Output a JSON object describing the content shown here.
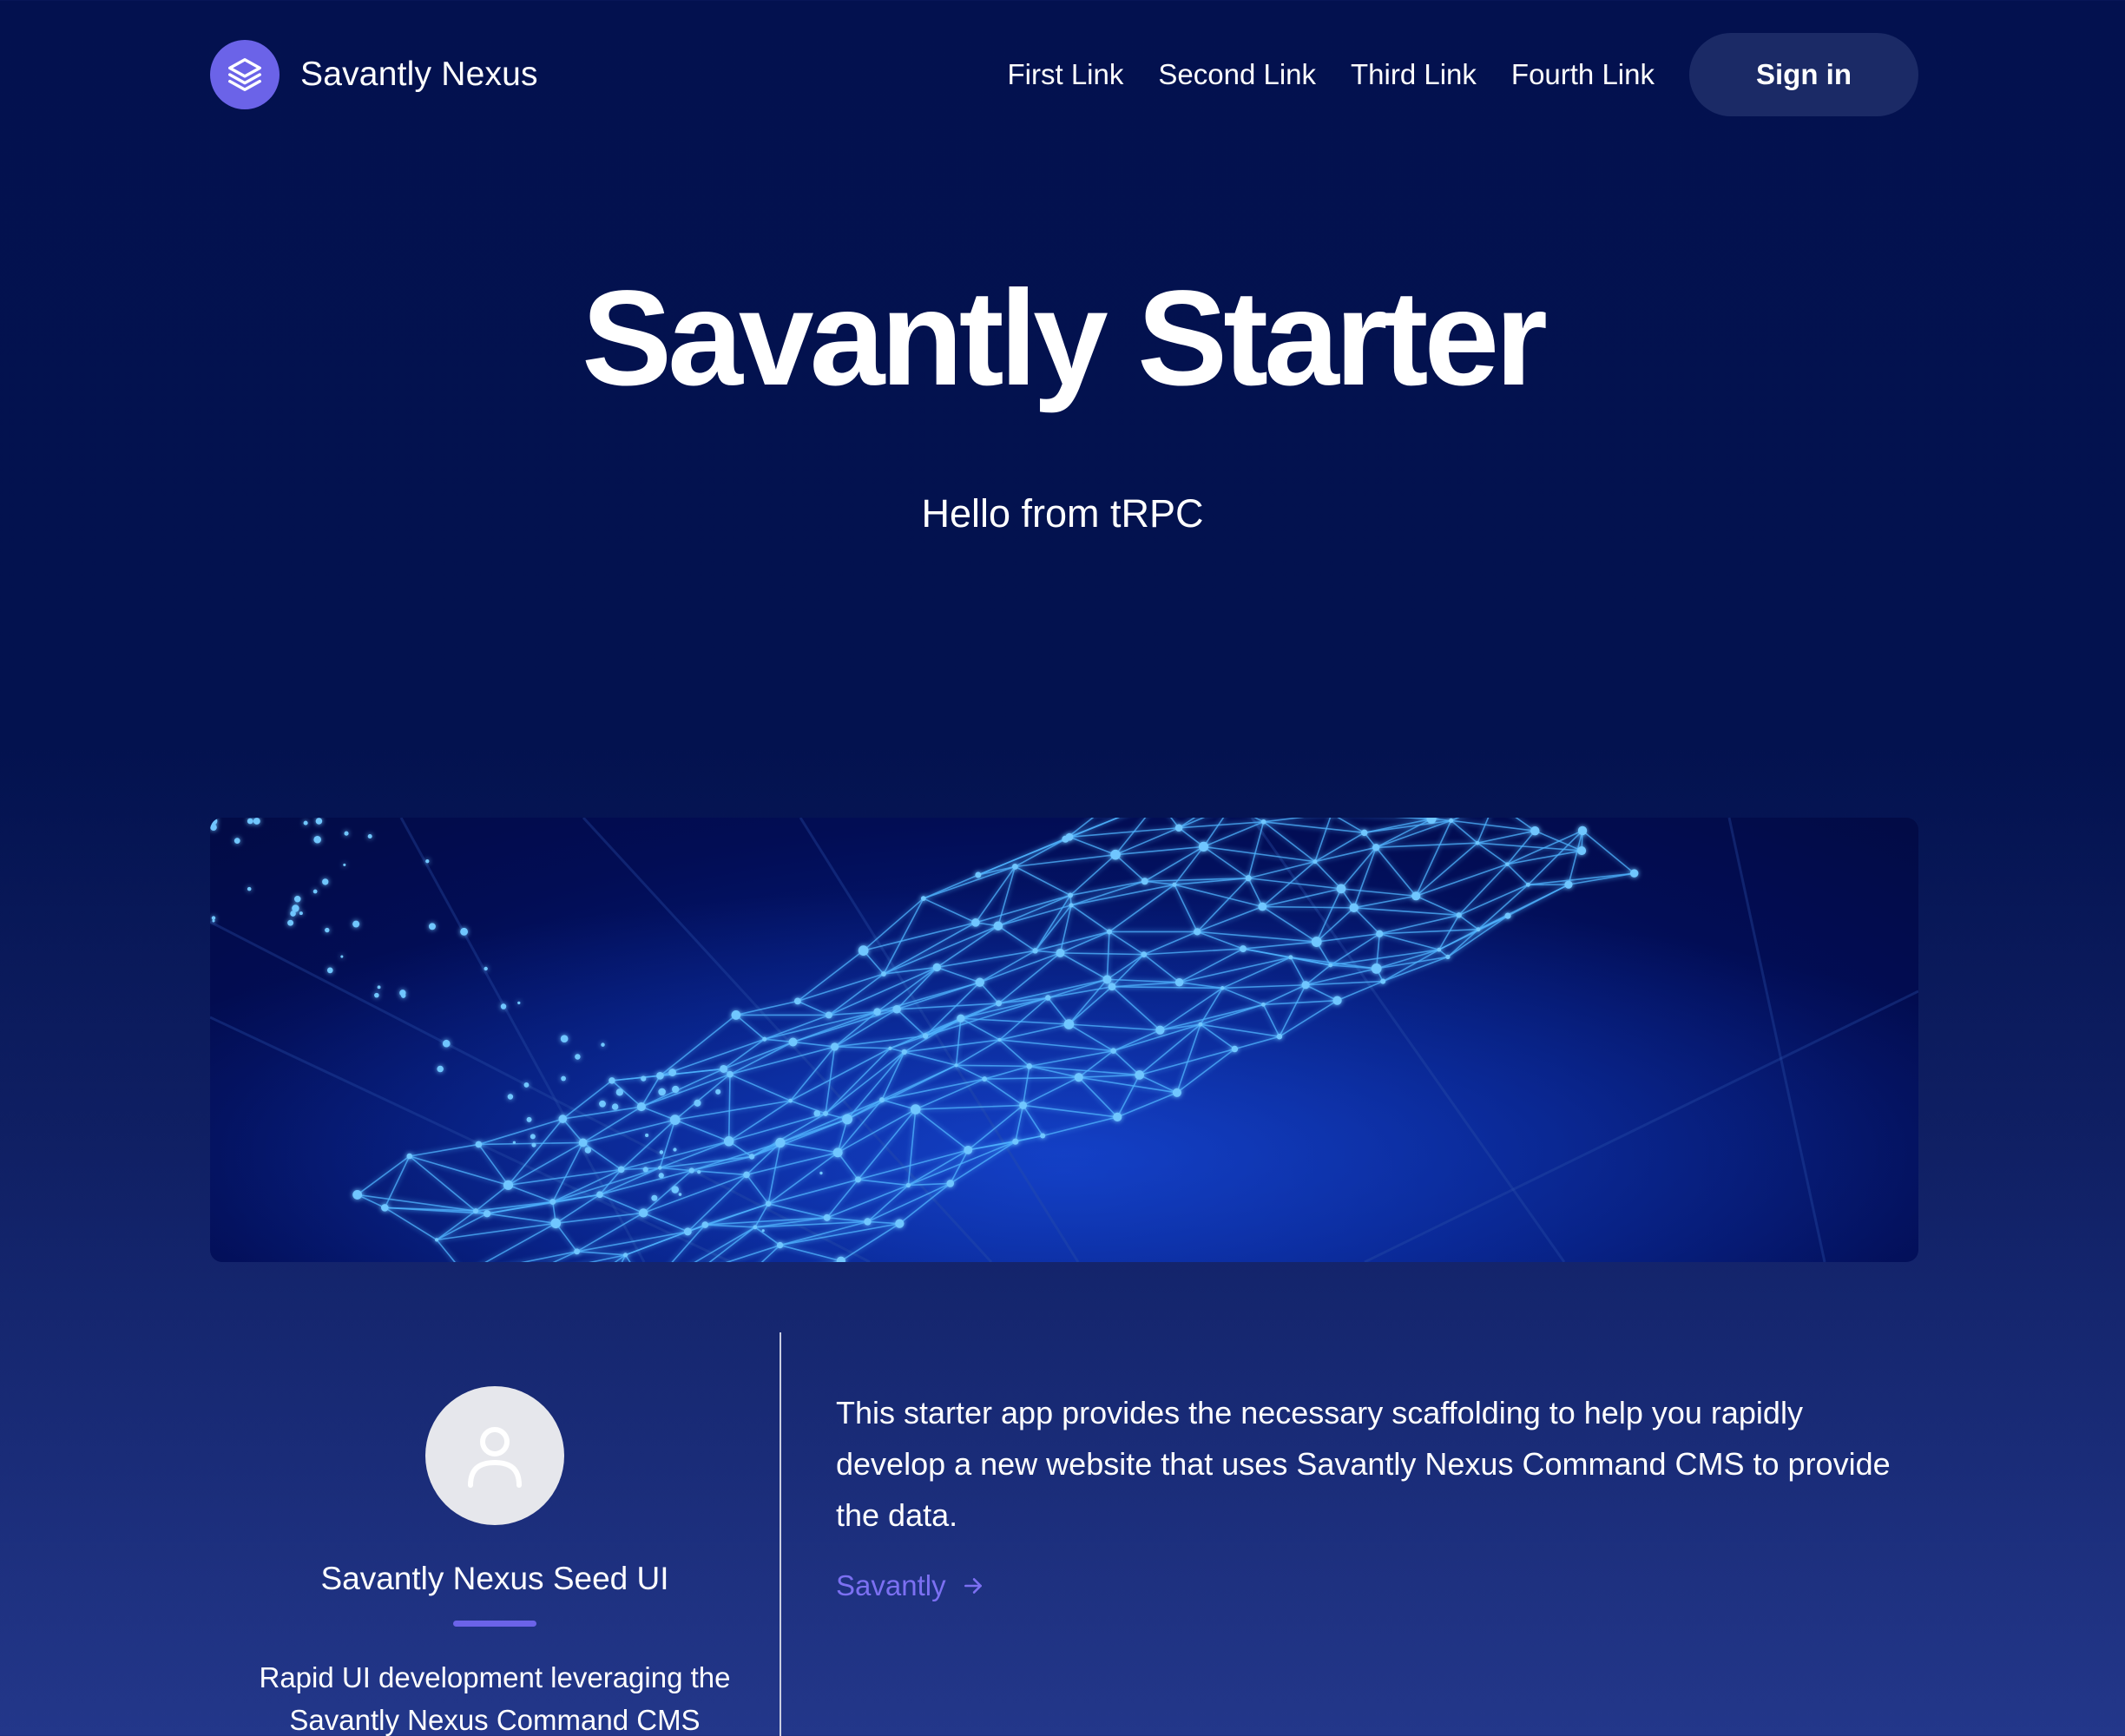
{
  "header": {
    "brand_name": "Savantly Nexus",
    "brand_icon": "layers-icon",
    "links": [
      "First Link",
      "Second Link",
      "Third Link",
      "Fourth Link"
    ],
    "signin_label": "Sign in"
  },
  "hero": {
    "title": "Savantly Starter",
    "subtitle": "Hello from tRPC"
  },
  "banner": {
    "image": "abstract-network-mesh"
  },
  "profile": {
    "avatar_icon": "user-icon",
    "name": "Savantly Nexus Seed UI",
    "description": "Rapid UI development leveraging the Savantly Nexus Command CMS"
  },
  "about": {
    "text": "This starter app provides the necessary scaffolding to help you rapidly develop a new website that uses Savantly Nexus Command CMS to provide the data.",
    "link_label": "Savantly",
    "link_icon": "arrow-right-icon"
  },
  "colors": {
    "accent": "#6b63e8",
    "link": "#7c70f2",
    "background_top": "#03114f",
    "signin_bg": "#1b2a66"
  }
}
